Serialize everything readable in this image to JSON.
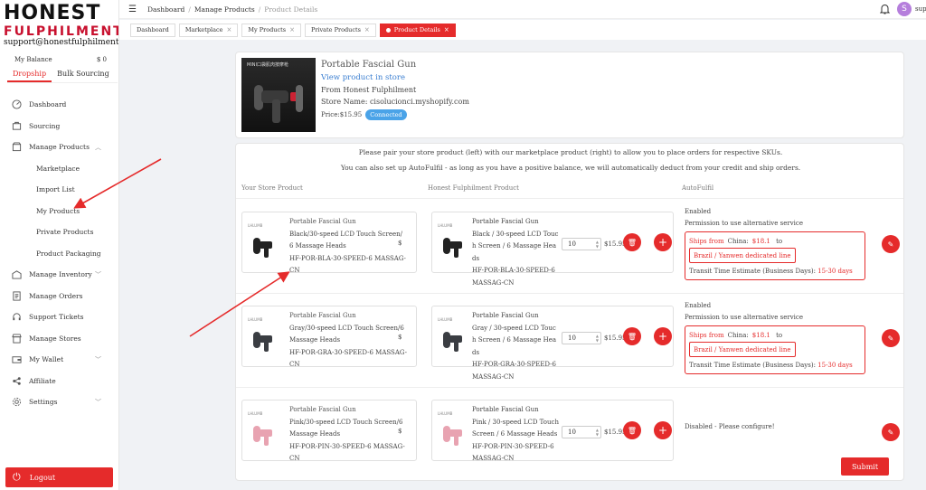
{
  "brand": {
    "line1": "HONEST",
    "line2": "FULPHILMENT"
  },
  "user": {
    "email": "support@honestfulphilment.co",
    "avatar_letter": "S",
    "name_short": "sup"
  },
  "balance": {
    "label": "My Balance",
    "value": "$ 0"
  },
  "modes": [
    {
      "label": "Dropship"
    },
    {
      "label": "Bulk Sourcing"
    }
  ],
  "menu": [
    {
      "label": "Dashboard"
    },
    {
      "label": "Sourcing"
    },
    {
      "label": "Manage Products"
    },
    {
      "label": "Marketplace"
    },
    {
      "label": "Import List"
    },
    {
      "label": "My Products"
    },
    {
      "label": "Private Products"
    },
    {
      "label": "Product Packaging"
    },
    {
      "label": "Manage Inventory"
    },
    {
      "label": "Manage Orders"
    },
    {
      "label": "Support Tickets"
    },
    {
      "label": "Manage Stores"
    },
    {
      "label": "My Wallet"
    },
    {
      "label": "Affiliate"
    },
    {
      "label": "Settings"
    }
  ],
  "logout_label": "Logout",
  "breadcrumb": {
    "a": "Dashboard",
    "b": "Manage Products",
    "c": "Product Details"
  },
  "tabs": [
    {
      "label": "Dashboard"
    },
    {
      "label": "Marketplace"
    },
    {
      "label": "My Products"
    },
    {
      "label": "Private Products"
    },
    {
      "label": "Product Details"
    }
  ],
  "product": {
    "image_caption": "MINI口袋肌肉按摩枪",
    "title": "Portable Fascial Gun",
    "view_link": "View product in store",
    "from": "From Honest Fulphilment",
    "store": "Store Name: cisolucionci.myshopify.com",
    "price_label": "Price:",
    "price": "$15.95",
    "status": "Connected"
  },
  "info": {
    "line1": "Please pair your store product (left) with our marketplace product (right) to allow you to place orders for respective SKUs.",
    "line2": "You can also set up AutoFulfil - as long as you have a positive balance, we will automatically deduct from your credit and ship orders."
  },
  "columns": {
    "store": "Your Store Product",
    "hf": "Honest Fulphilment Product",
    "auto": "AutoFulfil"
  },
  "rows": [
    {
      "brand": "LHLUMB",
      "gun_color": "#222222",
      "store_name": "Portable Fascial Gun",
      "store_variant": "Black/30-speed LCD Touch Screen/ 6 Massage Heads",
      "store_sku": "HF-POR-BLA-30-SPEED-6 MASSAG-CN",
      "store_price": "$",
      "hf_name": "Portable Fascial Gun",
      "hf_variant": "Black / 30-speed LCD Touch Screen / 6 Massage Heads",
      "hf_sku": "HF-POR-BLA-30-SPEED-6 MASSAG-CN",
      "qty": "10",
      "hf_price": "$15.95",
      "auto": {
        "status": "Enabled",
        "perm": "Permission to use alternative service",
        "ships_from": "Ships from",
        "origin": "China:",
        "ship_price": "$18.1",
        "to": "to",
        "line": "Brazil / Yanwen dedicated line",
        "transit_label": "Transit Time Estimate (Business Days):",
        "transit": "15-30 days"
      }
    },
    {
      "brand": "LHLUMB",
      "gun_color": "#3a3d42",
      "store_name": "Portable Fascial Gun",
      "store_variant": "Gray/30-speed LCD Touch Screen/6 Massage Heads",
      "store_sku": "HF-POR-GRA-30-SPEED-6 MASSAG-CN",
      "store_price": "$",
      "hf_name": "Portable Fascial Gun",
      "hf_variant": "Gray / 30-speed LCD Touch Screen / 6 Massage Heads",
      "hf_sku": "HF-POR-GRA-30-SPEED-6 MASSAG-CN",
      "qty": "10",
      "hf_price": "$15.95",
      "auto": {
        "status": "Enabled",
        "perm": "Permission to use alternative service",
        "ships_from": "Ships from",
        "origin": "China:",
        "ship_price": "$18.1",
        "to": "to",
        "line": "Brazil / Yanwen dedicated line",
        "transit_label": "Transit Time Estimate (Business Days):",
        "transit": "15-30 days"
      }
    },
    {
      "brand": "LHLUMB",
      "gun_color": "#e8a3b1",
      "store_name": "Portable Fascial Gun",
      "store_variant": "Pink/30-speed LCD Touch Screen/6 Massage Heads",
      "store_sku": "HF-POR-PIN-30-SPEED-6 MASSAG-CN",
      "store_price": "$",
      "hf_name": "Portable Fascial Gun",
      "hf_variant": "Pink / 30-speed LCD Touch Screen / 6 Massage Heads",
      "hf_sku": "HF-POR-PIN-30-SPEED-6 MASSAG-CN",
      "qty": "10",
      "hf_price": "$15.95",
      "auto": {
        "disabled": "Disabled - Please configure!"
      }
    }
  ],
  "submit_label": "Submit",
  "colors": {
    "accent": "#e52b2b",
    "link": "#3b7fd1",
    "badge": "#4aa3e8"
  }
}
